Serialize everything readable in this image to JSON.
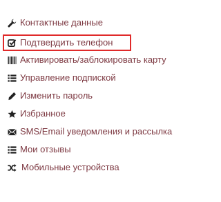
{
  "menu": {
    "items": [
      {
        "label": "Контактные данные",
        "icon": "wrench-icon"
      },
      {
        "label": "Подтвердить телефон",
        "icon": "check-square-icon",
        "highlighted": true,
        "highlight_color": "#e02a2a"
      },
      {
        "label": "Активировать/заблокировать карту",
        "icon": "barcode-icon"
      },
      {
        "label": "Управление подпиской",
        "icon": "list-icon"
      },
      {
        "label": "Изменить пароль",
        "icon": "pencil-icon"
      },
      {
        "label": "Избранное",
        "icon": "star-icon"
      },
      {
        "label": "SMS/Email уведомления и рассылка",
        "icon": "envelope-icon"
      },
      {
        "label": "Мои отзывы",
        "icon": "list-icon"
      },
      {
        "label": "Мобильные устройства",
        "icon": "random-icon"
      }
    ],
    "text_color": "#7d3942",
    "icon_color": "#222222"
  }
}
